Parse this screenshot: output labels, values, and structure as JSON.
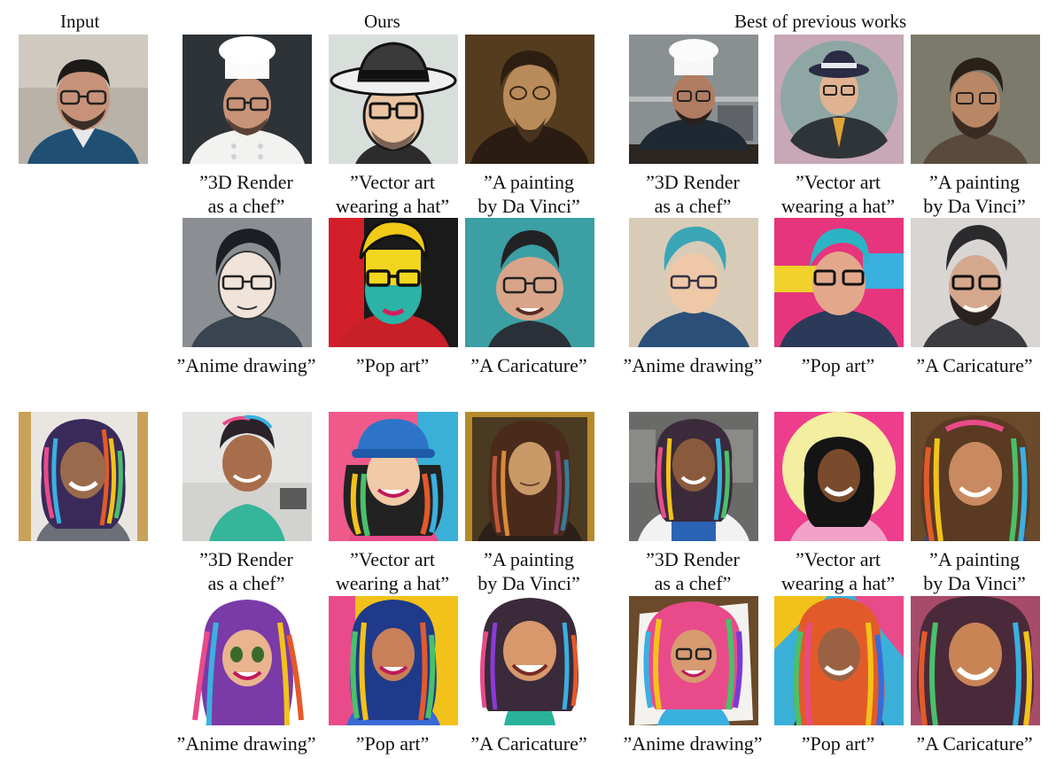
{
  "headers": {
    "input": "Input",
    "ours": "Ours",
    "previous": "Best of previous works"
  },
  "captions": {
    "chef": [
      "”3D Render",
      "as a chef”"
    ],
    "vector": [
      "”Vector art",
      "wearing a hat”"
    ],
    "painting": [
      "”A painting",
      "by Da Vinci”"
    ],
    "anime": [
      "”Anime drawing”"
    ],
    "pop": [
      "”Pop art”"
    ],
    "caricature": [
      "”A Caricature”"
    ]
  },
  "colors": {
    "text": "#111111",
    "bg": "#ffffff"
  }
}
